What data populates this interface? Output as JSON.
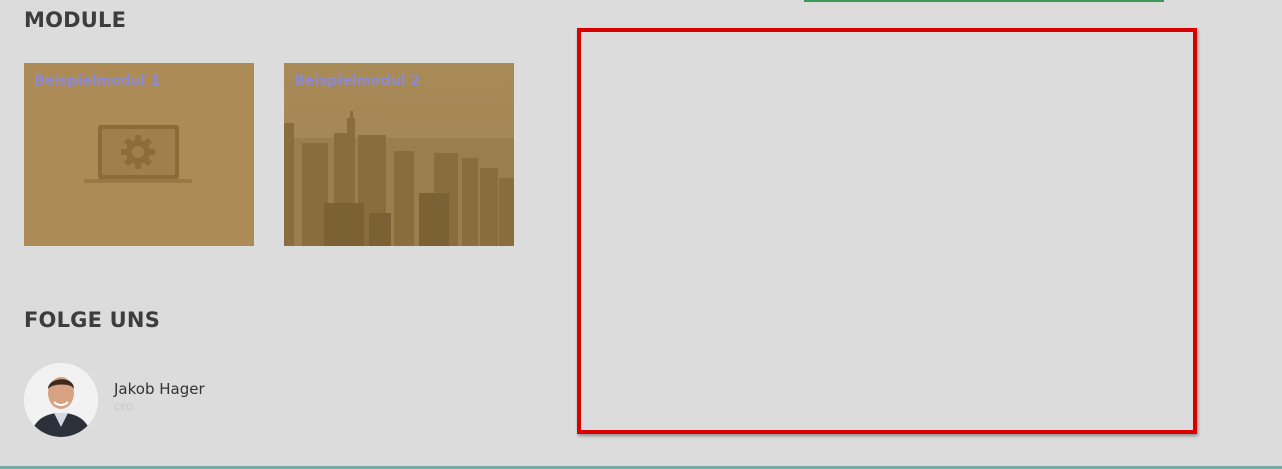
{
  "module_section": {
    "title": "MODULE",
    "cards": [
      {
        "label": "Beispielmodul 1",
        "image_icon": "laptop-gear-icon"
      },
      {
        "label": "Beispielmodul 2",
        "image_icon": "city-skyline-image"
      }
    ]
  },
  "follow_section": {
    "title": "FOLGE UNS",
    "member": {
      "name": "Jakob Hager",
      "role": "CEO",
      "avatar_icon": "person-portrait-avatar"
    }
  },
  "colors": {
    "background": "#dcdcdc",
    "card_overlay": "#ad8b57",
    "card_label": "#8c89d6",
    "highlight_border": "#d90000",
    "top_accent": "#3a9a55"
  }
}
